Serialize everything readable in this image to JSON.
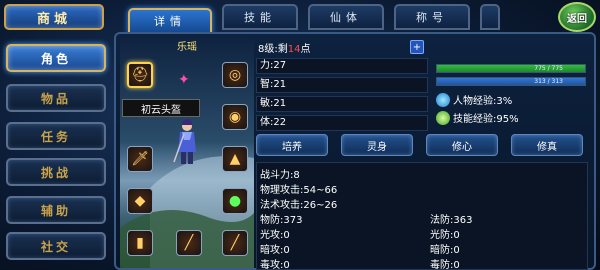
{
  "nav": {
    "shop": "商城",
    "items": [
      "角色",
      "物品",
      "任务",
      "挑战",
      "辅助",
      "社交"
    ]
  },
  "tabs": [
    "详情",
    "技能",
    "仙体",
    "称号",
    ""
  ],
  "back_label": "返回",
  "character": {
    "name": "乐瑶",
    "tooltip": "初云头盔"
  },
  "level_line": {
    "prefix": "8级:剩",
    "points": "14",
    "suffix": "点"
  },
  "base_stats": [
    "力:27",
    "智:21",
    "敏:21",
    "体:22"
  ],
  "bars": {
    "hp": {
      "text": "775 / 775",
      "fraction": 1.0,
      "color": "#2fbf3a"
    },
    "mp": {
      "text": "313 / 313",
      "fraction": 1.0,
      "color": "#2f76d6"
    }
  },
  "experience": {
    "character": "人物经验:3%",
    "skill": "技能经验:95%"
  },
  "actions": [
    "培养",
    "灵身",
    "修心",
    "修真"
  ],
  "attributes": {
    "power": "战斗力:8",
    "phys_attack": "物理攻击:54~66",
    "magic_attack": "法术攻击:26~26",
    "phys_def": "物防:373",
    "magic_def": "法防:363",
    "light_atk": "光攻:0",
    "light_def": "光防:0",
    "dark_atk": "暗攻:0",
    "dark_def": "暗防:0",
    "extra_left": "毒攻:0",
    "extra_right": "毒防:0"
  },
  "colors": {
    "accent_gold": "#d9b45a",
    "active_blue": "#2b74cf",
    "level_points_red": "#ff4a4a"
  }
}
